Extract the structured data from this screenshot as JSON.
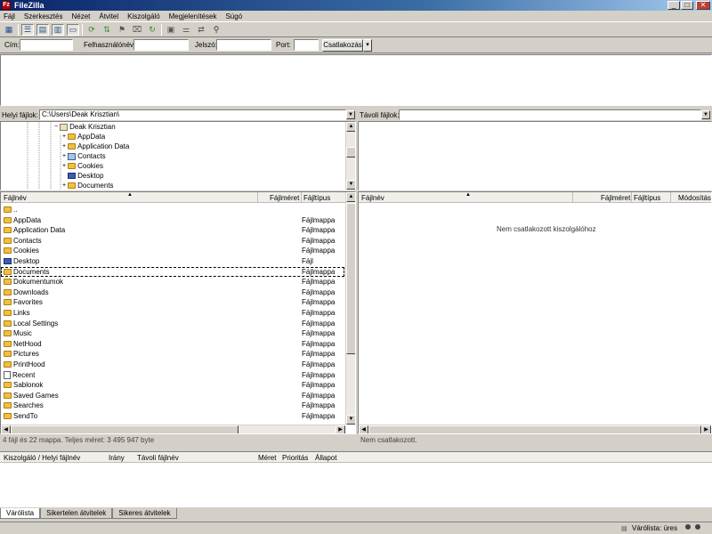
{
  "window": {
    "app_icon_text": "Fz",
    "title": "FileZilla",
    "minimize": "_",
    "maximize": "□",
    "close": "✕"
  },
  "menu": [
    "Fájl",
    "Szerkesztés",
    "Nézet",
    "Átvitel",
    "Kiszolgáló",
    "Megjelenítések",
    "Súgó"
  ],
  "quickconnect": {
    "host_label": "Cím:",
    "user_label": "Felhasználónév:",
    "password_label": "Jelszó:",
    "port_label": "Port:",
    "connect_button": "Csatlakozás",
    "dropdown": "▾"
  },
  "local": {
    "path_label": "Helyi fájlok:",
    "path_value": "C:\\Users\\Deak Krisztian\\",
    "tree": [
      {
        "label": "Deak Krisztian",
        "icon": "user"
      },
      {
        "label": "AppData",
        "icon": "folder"
      },
      {
        "label": "Application Data",
        "icon": "folder"
      },
      {
        "label": "Contacts",
        "icon": "contacts"
      },
      {
        "label": "Cookies",
        "icon": "folder"
      },
      {
        "label": "Desktop",
        "icon": "desktop"
      },
      {
        "label": "Documents",
        "icon": "folder"
      }
    ],
    "columns": {
      "name": "Fájlnév",
      "size": "Fájlméret",
      "type": "Fájltípus"
    },
    "files": [
      {
        "name": "..",
        "type": "",
        "icon": "folder"
      },
      {
        "name": "AppData",
        "type": "Fájlmappa",
        "icon": "folder"
      },
      {
        "name": "Application Data",
        "type": "Fájlmappa",
        "icon": "folder"
      },
      {
        "name": "Contacts",
        "type": "Fájlmappa",
        "icon": "folder"
      },
      {
        "name": "Cookies",
        "type": "Fájlmappa",
        "icon": "folder"
      },
      {
        "name": "Desktop",
        "type": "Fájl",
        "icon": "desktop"
      },
      {
        "name": "Documents",
        "type": "Fájlmappa",
        "icon": "folder"
      },
      {
        "name": "Dokumentumok",
        "type": "Fájlmappa",
        "icon": "folder"
      },
      {
        "name": "Downloads",
        "type": "Fájlmappa",
        "icon": "folder"
      },
      {
        "name": "Favorites",
        "type": "Fájlmappa",
        "icon": "folder"
      },
      {
        "name": "Links",
        "type": "Fájlmappa",
        "icon": "folder"
      },
      {
        "name": "Local Settings",
        "type": "Fájlmappa",
        "icon": "folder"
      },
      {
        "name": "Music",
        "type": "Fájlmappa",
        "icon": "folder"
      },
      {
        "name": "NetHood",
        "type": "Fájlmappa",
        "icon": "folder"
      },
      {
        "name": "Pictures",
        "type": "Fájlmappa",
        "icon": "folder"
      },
      {
        "name": "PrintHood",
        "type": "Fájlmappa",
        "icon": "folder"
      },
      {
        "name": "Recent",
        "type": "Fájlmappa",
        "icon": "file"
      },
      {
        "name": "Sablonok",
        "type": "Fájlmappa",
        "icon": "folder"
      },
      {
        "name": "Saved Games",
        "type": "Fájlmappa",
        "icon": "folder"
      },
      {
        "name": "Searches",
        "type": "Fájlmappa",
        "icon": "folder"
      },
      {
        "name": "SendTo",
        "type": "Fájlmappa",
        "icon": "folder"
      }
    ],
    "status": "4 fájl és 22 mappa. Teljes méret: 3 495 947 byte"
  },
  "remote": {
    "path_label": "Távoli fájlok:",
    "path_value": "",
    "columns": {
      "name": "Fájlnév",
      "size": "Fájlméret",
      "type": "Fájltípus",
      "modified": "Módosítás"
    },
    "empty_message": "Nem csatlakozott kiszolgálóhoz",
    "status": "Nem csatlakozott."
  },
  "queue": {
    "columns": {
      "server": "Kiszolgáló / Helyi fájlnév",
      "direction": "Irány",
      "remote": "Távoli fájlnév",
      "size": "Méret",
      "priority": "Prioritás",
      "status": "Állapot"
    },
    "tabs": [
      "Várólista",
      "Sikertelen átvitelek",
      "Sikeres átvitelek"
    ]
  },
  "statusbar": {
    "queue_text": "Várólista: üres"
  },
  "toolbar_icons": [
    "site-manager-icon",
    "toggle-log-icon",
    "toggle-tree-icon",
    "toggle-remote-tree-icon",
    "toggle-queue-icon",
    "refresh-icon",
    "process-queue-icon",
    "cancel-icon",
    "disconnect-icon",
    "reconnect-icon",
    "directory-listing-filter-icon",
    "compare-icon",
    "sync-browse-icon",
    "search-icon"
  ]
}
